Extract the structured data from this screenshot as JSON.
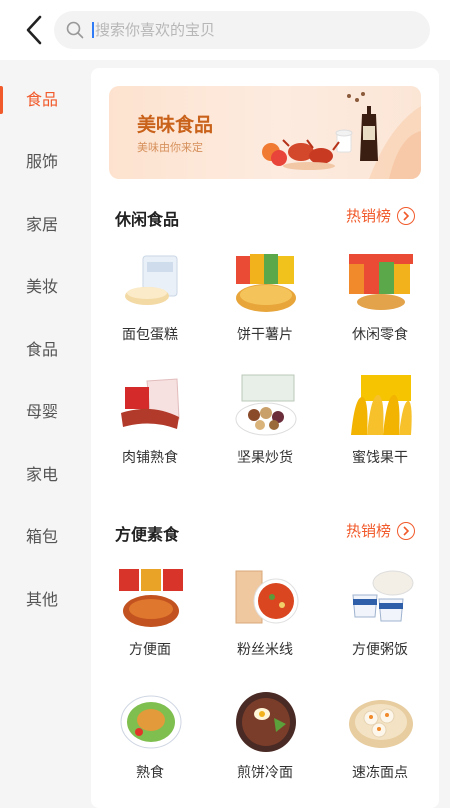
{
  "search": {
    "placeholder": "搜索你喜欢的宝贝"
  },
  "sidebar": {
    "items": [
      {
        "label": "食品"
      },
      {
        "label": "服饰"
      },
      {
        "label": "家居"
      },
      {
        "label": "美妆"
      },
      {
        "label": "食品"
      },
      {
        "label": "母婴"
      },
      {
        "label": "家电"
      },
      {
        "label": "箱包"
      },
      {
        "label": "其他"
      }
    ],
    "active_index": 0
  },
  "banner": {
    "title": "美味食品",
    "subtitle": "美味由你来定"
  },
  "sections": [
    {
      "title": "休闲食品",
      "hot_label": "热销榜",
      "items": [
        {
          "label": "面包蛋糕",
          "icon": "bread-cake-icon"
        },
        {
          "label": "饼干薯片",
          "icon": "chips-icon"
        },
        {
          "label": "休闲零食",
          "icon": "snacks-icon"
        },
        {
          "label": "肉铺熟食",
          "icon": "jerky-icon"
        },
        {
          "label": "坚果炒货",
          "icon": "nuts-icon"
        },
        {
          "label": "蜜饯果干",
          "icon": "dried-mango-icon"
        }
      ]
    },
    {
      "title": "方便素食",
      "hot_label": "热销榜",
      "items": [
        {
          "label": "方便面",
          "icon": "instant-noodles-icon"
        },
        {
          "label": "粉丝米线",
          "icon": "rice-noodles-icon"
        },
        {
          "label": "方便粥饭",
          "icon": "porridge-icon"
        },
        {
          "label": "熟食",
          "icon": "cooked-food-icon"
        },
        {
          "label": "煎饼冷面",
          "icon": "cold-noodles-icon"
        },
        {
          "label": "速冻面点",
          "icon": "dumplings-icon"
        }
      ]
    }
  ],
  "colors": {
    "accent": "#f15a2b",
    "banner_text": "#c9621b",
    "cursor": "#2f7cf6"
  }
}
